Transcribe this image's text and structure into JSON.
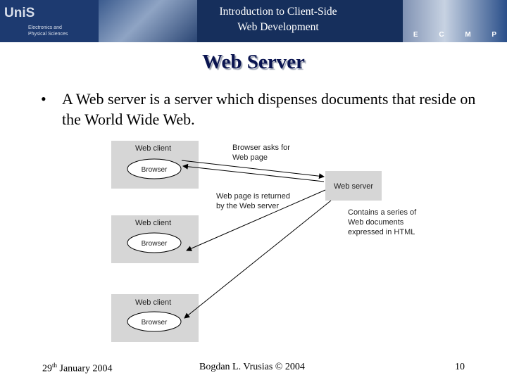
{
  "header": {
    "logo_main": "UniS",
    "logo_sub_1": "Electronics and",
    "logo_sub_2": "Physical Sciences",
    "title_line1": "Introduction to Client-Side",
    "title_line2": "Web Development",
    "ecmp": [
      "E",
      "C",
      "M",
      "P"
    ]
  },
  "slide": {
    "title": "Web Server",
    "bullet": "A Web server is a server which dispenses documents that reside on the World Wide Web."
  },
  "diagram": {
    "client_label": "Web client",
    "browser_label": "Browser",
    "server_label": "Web server",
    "request_line1": "Browser asks for",
    "request_line2": "Web page",
    "response_line1": "Web page is returned",
    "response_line2": "by the Web server",
    "docs_line1": "Contains a series of",
    "docs_line2": "Web documents",
    "docs_line3": "expressed in HTML"
  },
  "footer": {
    "date_day": "29",
    "date_suffix": "th",
    "date_rest": " January 2004",
    "author": "Bogdan L. Vrusias © 2004",
    "page": "10"
  }
}
